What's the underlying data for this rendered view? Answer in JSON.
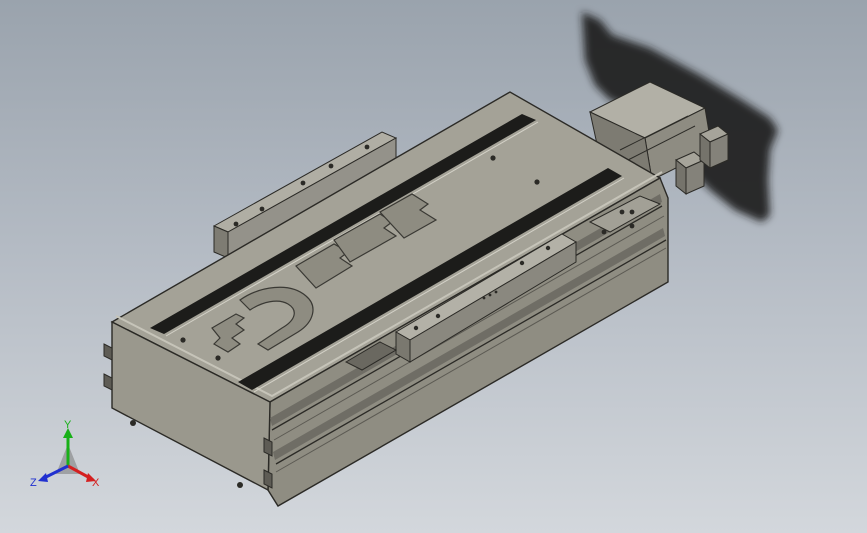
{
  "viewport": {
    "background_top": "#9aa3ad",
    "background_bottom": "#d3d7dc"
  },
  "model": {
    "body_color": "#8f8d82",
    "top_color": "#a4a297",
    "edge_color": "#2b2a26",
    "slot_color": "#1c1c1a",
    "shadow_color": "#1a1a1a",
    "engraving_text": "TBI"
  },
  "triad": {
    "x_label": "X",
    "y_label": "Y",
    "z_label": "Z",
    "x_color": "#d42020",
    "y_color": "#18b018",
    "z_color": "#2030d0"
  }
}
